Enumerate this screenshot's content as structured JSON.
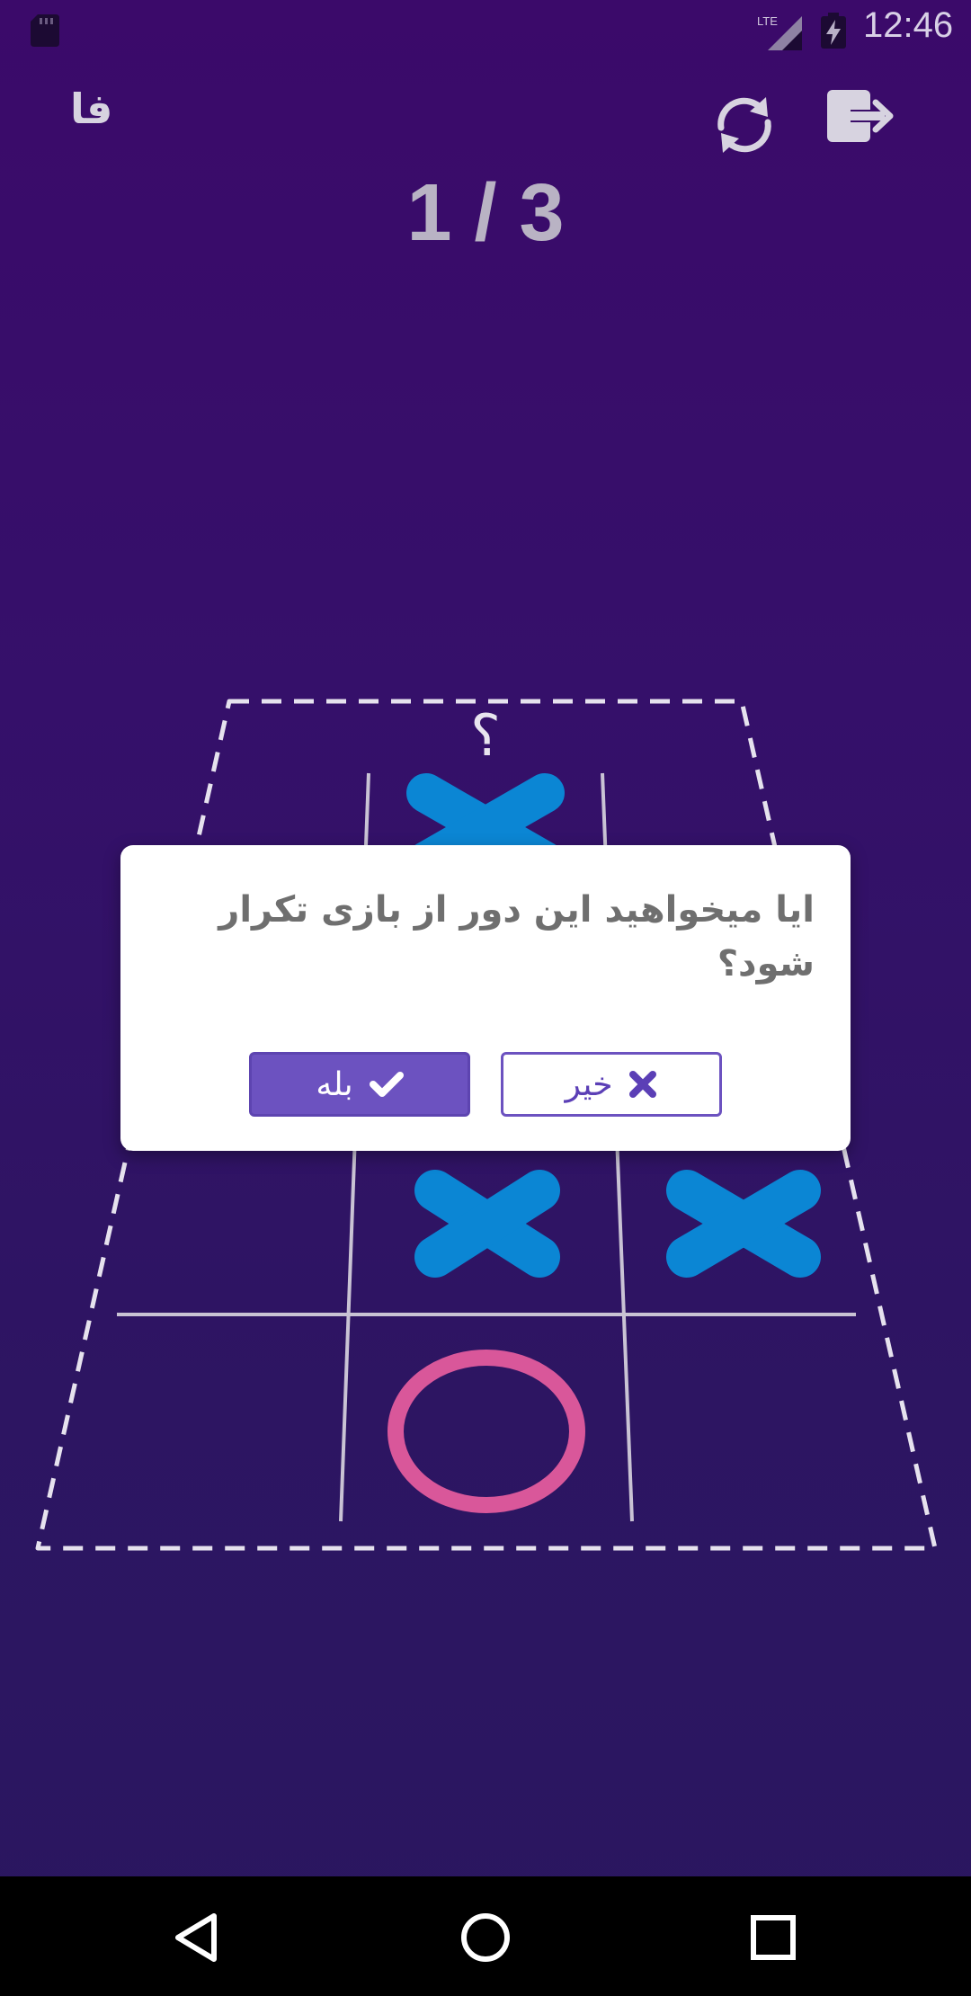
{
  "status_bar": {
    "time": "12:46",
    "network_label": "LTE",
    "icons": [
      "sd-card-icon",
      "signal-icon",
      "battery-charging-icon"
    ]
  },
  "toolbar": {
    "language_label": "فا",
    "restart_icon": "refresh-icon",
    "exit_icon": "exit-icon"
  },
  "game": {
    "round_text": "1 / 3",
    "turn_indicator": "؟",
    "board": [
      [
        "",
        "X",
        ""
      ],
      [
        "",
        "X",
        "X"
      ],
      [
        "",
        "O",
        ""
      ]
    ],
    "x_color": "#0b86d4",
    "o_color": "#d9579a"
  },
  "dialog": {
    "message": "ایا میخواهید این دور از بازی تکرار شود؟",
    "yes_label": "بله",
    "no_label": "خیر"
  },
  "colors": {
    "accent": "#6c52c0",
    "background_top": "#3b0a6a",
    "background_bottom": "#2a1760"
  },
  "nav_bar": {
    "icons": [
      "back-icon",
      "home-icon",
      "recents-icon"
    ]
  }
}
